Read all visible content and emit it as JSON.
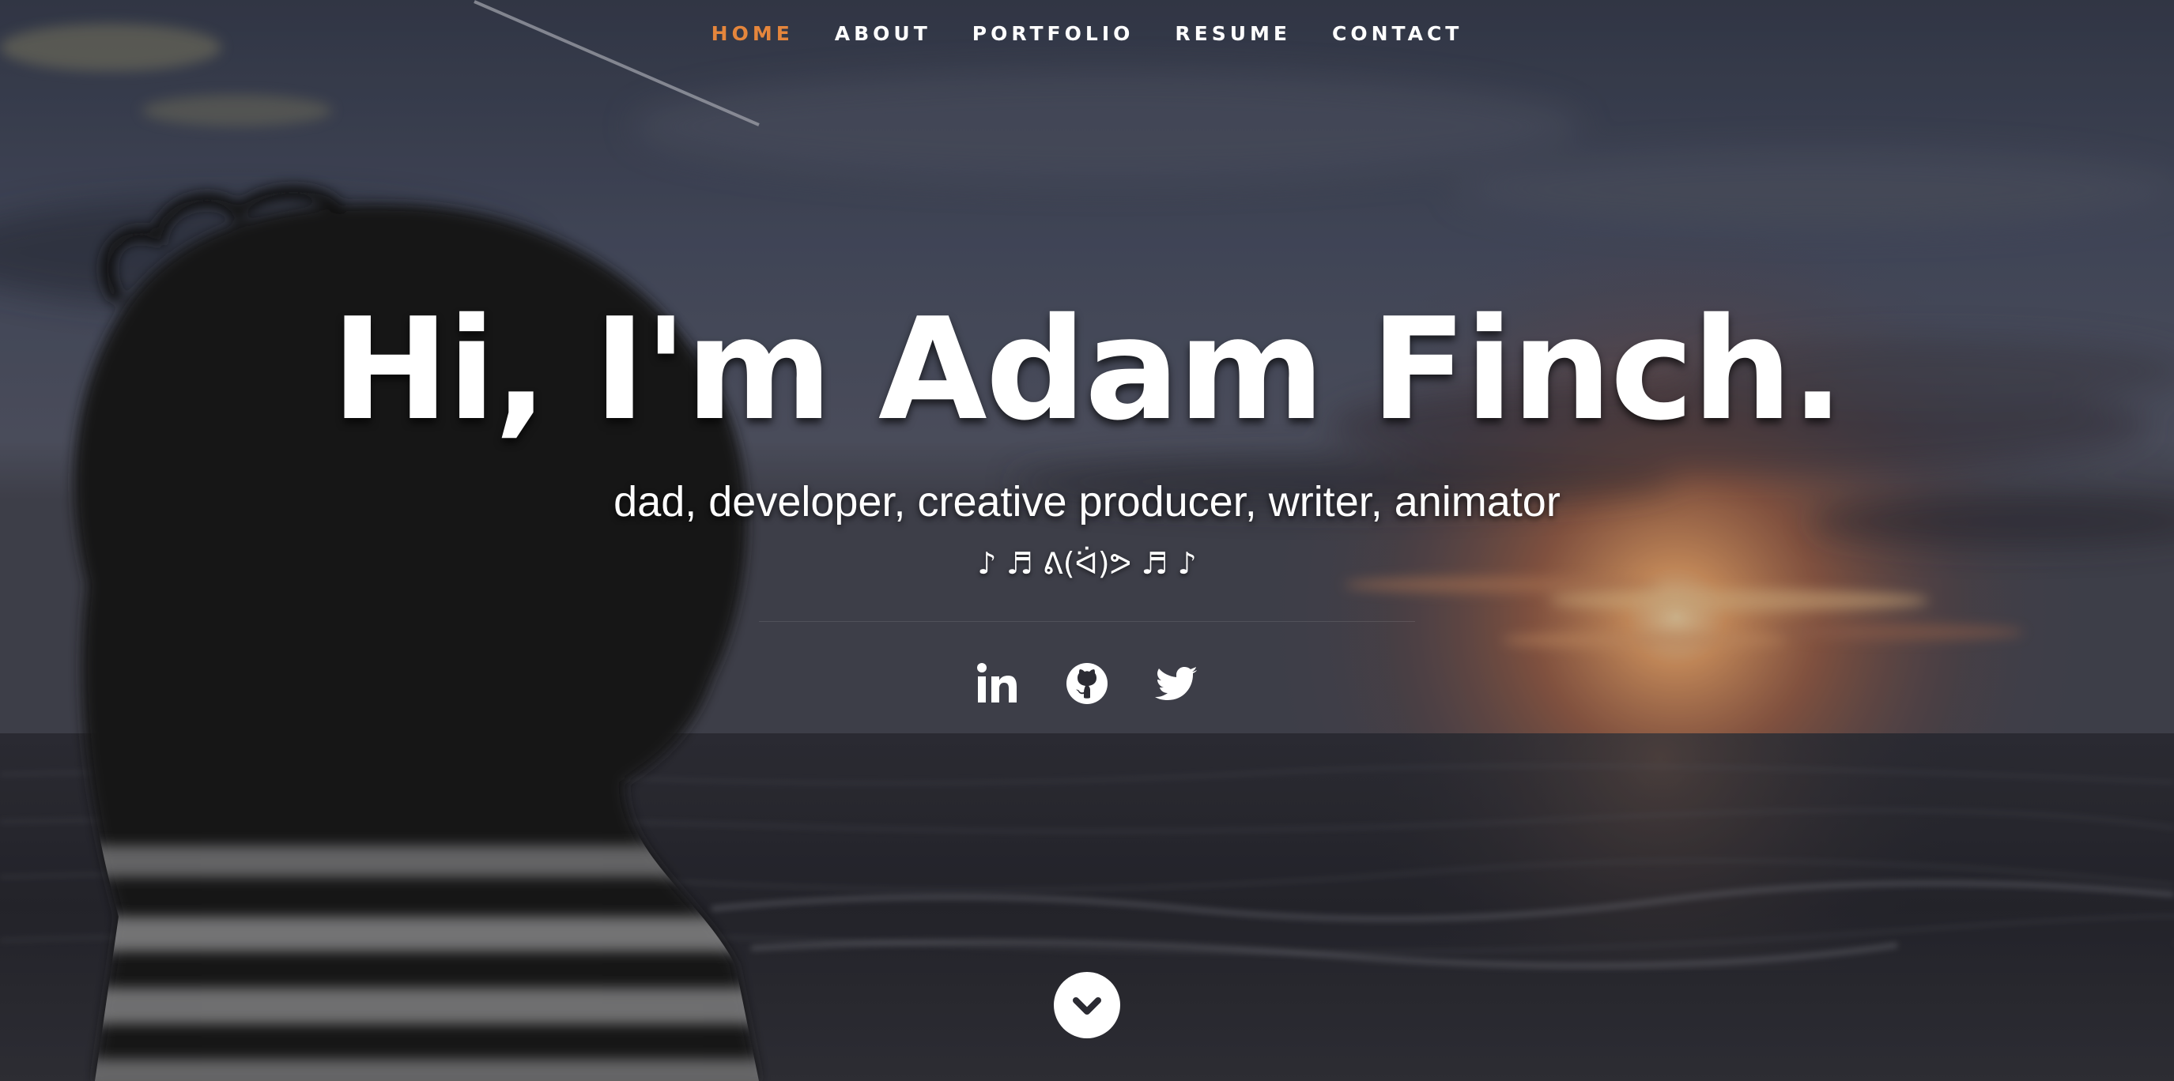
{
  "nav": {
    "items": [
      {
        "label": "HOME",
        "active": true
      },
      {
        "label": "ABOUT",
        "active": false
      },
      {
        "label": "PORTFOLIO",
        "active": false
      },
      {
        "label": "RESUME",
        "active": false
      },
      {
        "label": "CONTACT",
        "active": false
      }
    ]
  },
  "banner": {
    "headline": "Hi, I'm Adam Finch.",
    "tagline": "dad, developer, creative producer, writer, animator",
    "kaomoji": "♪ ♬ ᕕ(ᐛ)ᕗ ♬ ♪"
  },
  "social": [
    {
      "icon": "linkedin-icon"
    },
    {
      "icon": "github-icon"
    },
    {
      "icon": "twitter-icon"
    }
  ],
  "scroll": {
    "icon": "chevron-down-icon"
  },
  "colors": {
    "accent": "#e5863c",
    "text": "#ffffff"
  }
}
